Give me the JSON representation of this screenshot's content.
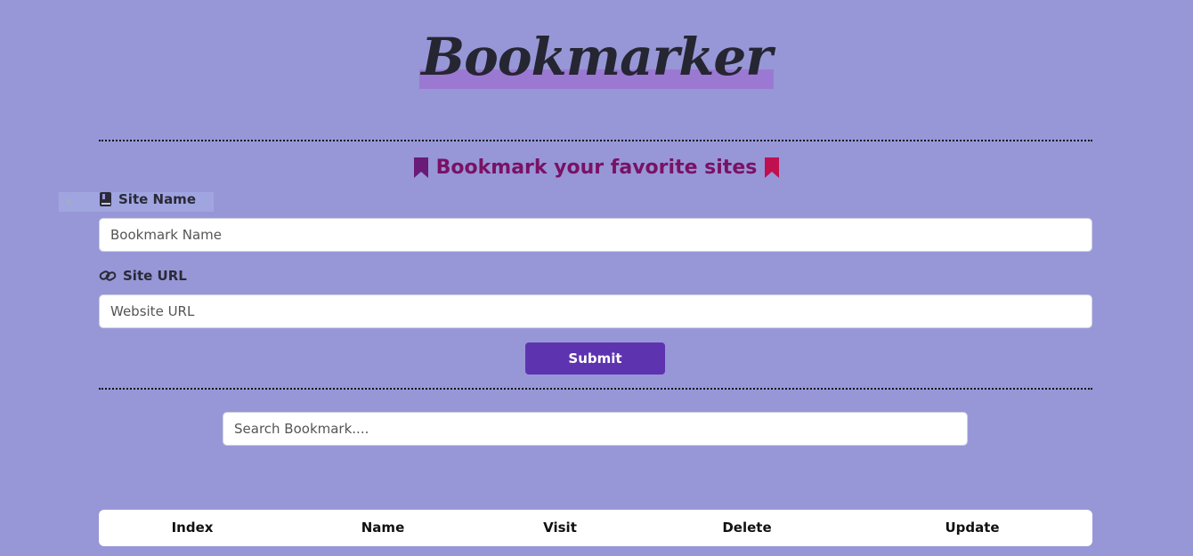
{
  "header": {
    "logo": "Bookmarker",
    "subtitle": "Bookmark your favorite sites"
  },
  "form": {
    "site_name_label": "Site Name",
    "site_name_placeholder": "Bookmark Name",
    "site_url_label": "Site URL",
    "site_url_placeholder": "Website URL",
    "submit_label": "Submit"
  },
  "search": {
    "placeholder": "Search Bookmark...."
  },
  "table": {
    "columns": [
      "Index",
      "Name",
      "Visit",
      "Delete",
      "Update"
    ]
  },
  "icons": {
    "subtitle_left": "bookmark-icon",
    "subtitle_right": "bookmark-icon",
    "site_name": "book-icon",
    "site_url": "link-icon"
  },
  "colors": {
    "background": "#9797d7",
    "accent": "#5e33b0",
    "subtitle": "#7a1165",
    "bookmark_left": "#6a1a78",
    "bookmark_right": "#c0104f",
    "logo_highlight": "#9b79d2"
  }
}
